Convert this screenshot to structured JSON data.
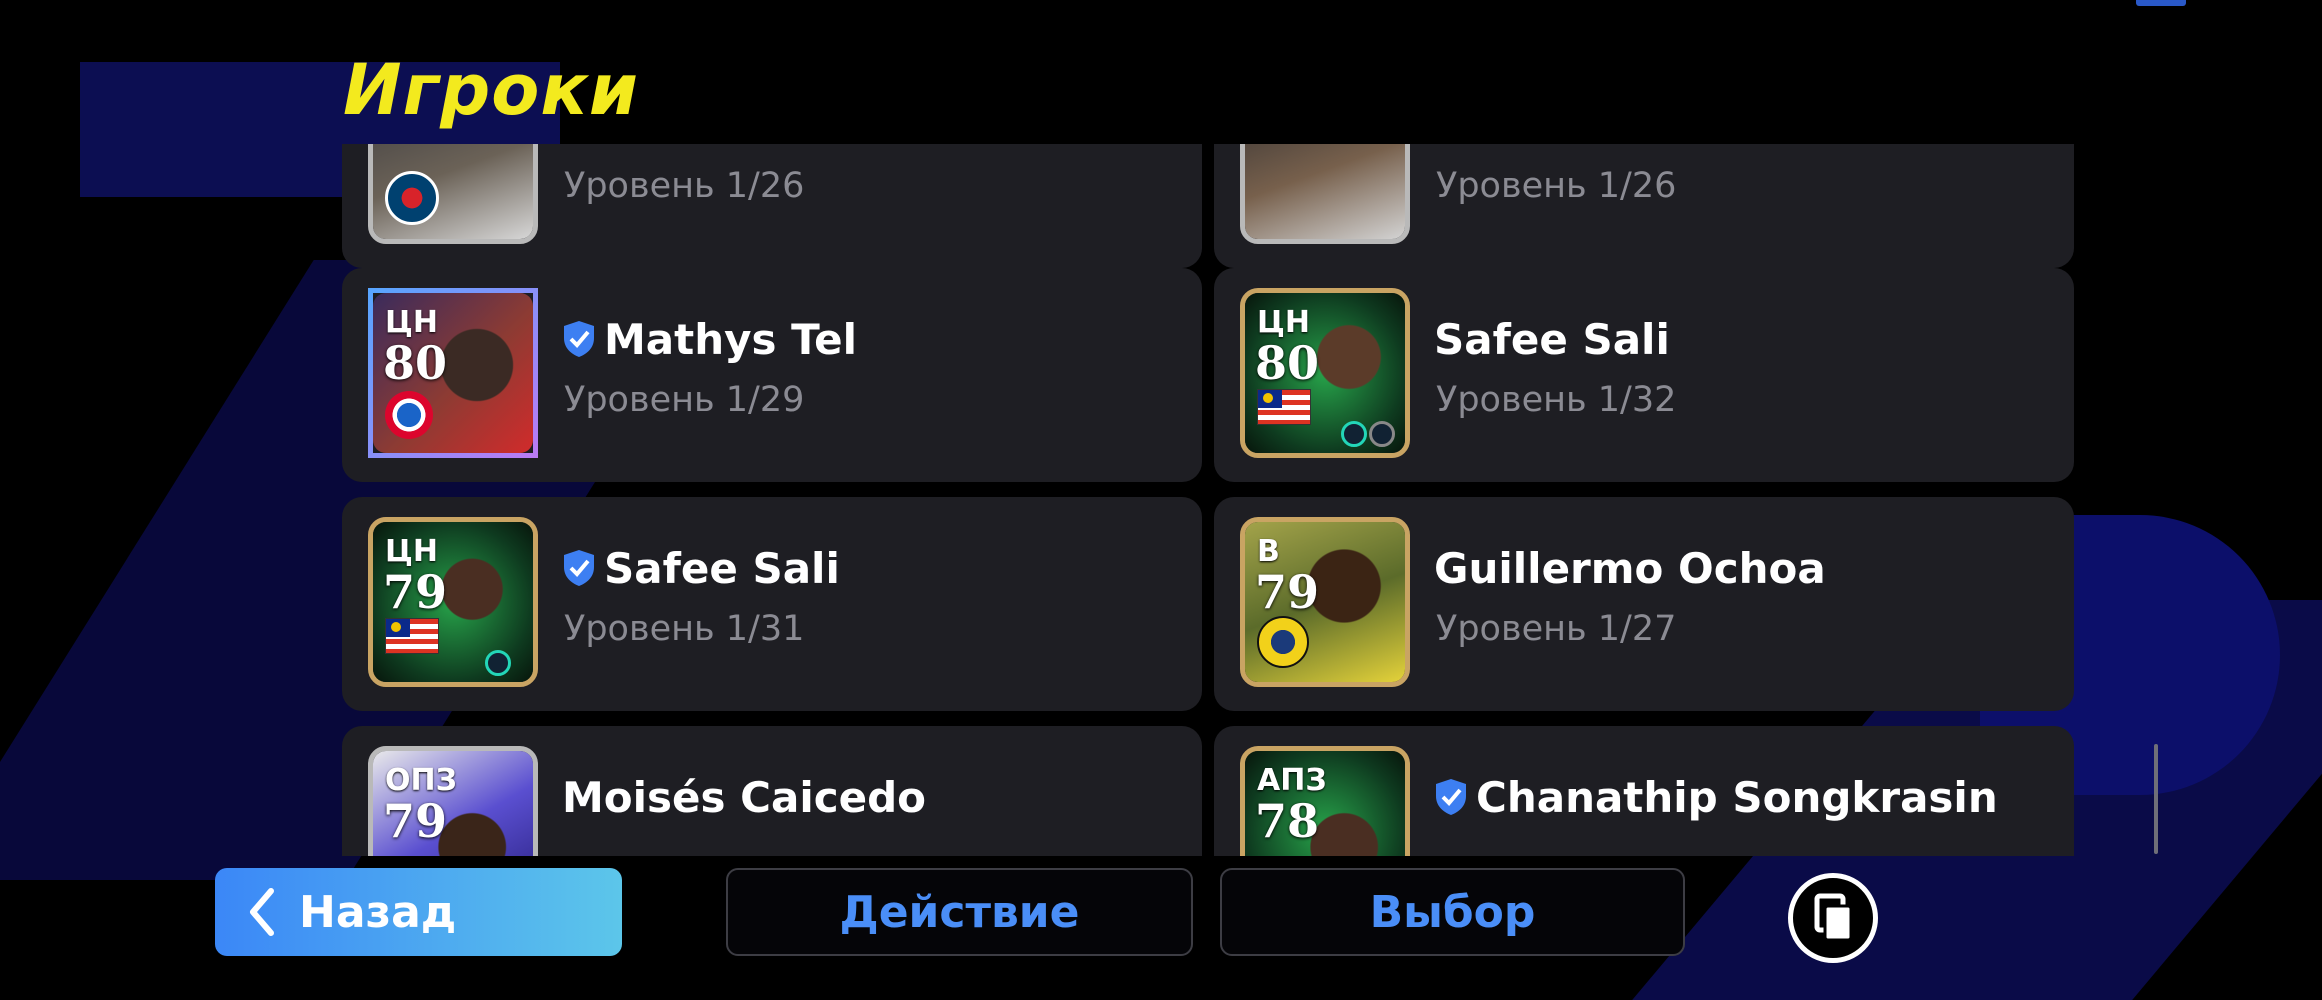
{
  "header": {
    "title": "Игроки"
  },
  "players": [
    {
      "position": "",
      "rating": "",
      "name": "",
      "level": "Уровень 1/26",
      "verified": false,
      "club": "PSG"
    },
    {
      "position": "",
      "rating": "",
      "name": "",
      "level": "Уровень 1/26",
      "verified": false,
      "club": ""
    },
    {
      "position": "ЦН",
      "rating": "80",
      "name": "Mathys Tel",
      "level": "Уровень 1/29",
      "verified": true,
      "club": "Bayern"
    },
    {
      "position": "ЦН",
      "rating": "80",
      "name": "Safee Sali",
      "level": "Уровень 1/32",
      "verified": false,
      "club": "Malaysia"
    },
    {
      "position": "ЦН",
      "rating": "79",
      "name": "Safee Sali",
      "level": "Уровень 1/31",
      "verified": true,
      "club": "Malaysia"
    },
    {
      "position": "В",
      "rating": "79",
      "name": "Guillermo Ochoa",
      "level": "Уровень 1/27",
      "verified": false,
      "club": "América"
    },
    {
      "position": "ОПЗ",
      "rating": "79",
      "name": "Moisés Caicedo",
      "level": "",
      "verified": false,
      "club": ""
    },
    {
      "position": "АПЗ",
      "rating": "78",
      "name": "Chanathip Songkrasin",
      "level": "",
      "verified": true,
      "club": ""
    }
  ],
  "footer": {
    "back_label": "Назад",
    "action_label": "Действие",
    "select_label": "Выбор"
  },
  "colors": {
    "title": "#f3ea1e",
    "accent": "#4a8ef7",
    "card": "#1e1e23",
    "level_text": "#8b8b93"
  }
}
